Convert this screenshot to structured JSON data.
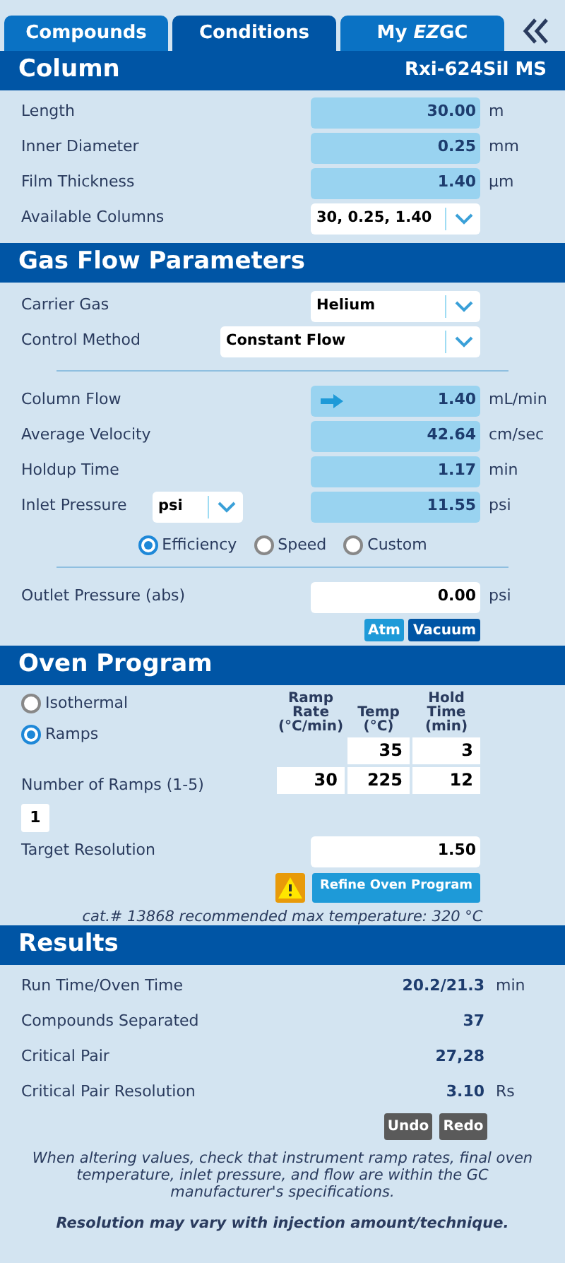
{
  "tabs": [
    {
      "label": "Compounds",
      "selected": false
    },
    {
      "label": "Conditions",
      "selected": true
    },
    {
      "parts": [
        {
          "text": "My ",
          "italic": false
        },
        {
          "text": "EZ",
          "italic": true
        },
        {
          "text": "GC",
          "italic": false
        }
      ],
      "selected": false
    }
  ],
  "column": {
    "title": "Column",
    "name": "Rxi-624Sil MS",
    "fields": [
      {
        "label": "Length",
        "value": "30.00",
        "unit": "m"
      },
      {
        "label": "Inner Diameter",
        "value": "0.25",
        "unit": "mm"
      },
      {
        "label": "Film Thickness",
        "value": "1.40",
        "unit": "µm"
      }
    ],
    "available": {
      "label": "Available Columns",
      "value": "30, 0.25, 1.40"
    }
  },
  "gas_flow": {
    "title": "Gas Flow Parameters",
    "selects": [
      {
        "label": "Carrier Gas",
        "value": "Helium",
        "kind": "short"
      },
      {
        "label": "Control Method",
        "value": "Constant Flow",
        "kind": "wide"
      }
    ],
    "fields": [
      {
        "label": "Column Flow",
        "value": "1.40",
        "unit": "mL/min",
        "kind": "arrow"
      },
      {
        "label": "Average Velocity",
        "value": "42.64",
        "unit": "cm/sec",
        "kind": "plain"
      },
      {
        "label": "Holdup Time",
        "value": "1.17",
        "unit": "min",
        "kind": "plain"
      }
    ],
    "inlet": {
      "label": "Inlet Pressure",
      "unit_select": "psi",
      "value": "11.55",
      "unit": "psi"
    },
    "modes": [
      {
        "label": "Efficiency",
        "selected": true
      },
      {
        "label": "Speed",
        "selected": false
      },
      {
        "label": "Custom",
        "selected": false
      }
    ],
    "outlet": {
      "label": "Outlet Pressure (abs)",
      "value": "0.00",
      "unit": "psi"
    },
    "buttons": [
      {
        "label": "Atm",
        "kind": "light"
      },
      {
        "label": "Vacuum",
        "kind": "dark"
      }
    ]
  },
  "oven": {
    "title": "Oven Program",
    "modes": [
      {
        "label": "Isothermal",
        "selected": false
      },
      {
        "label": "Ramps",
        "selected": true
      }
    ],
    "headers": [
      "Ramp Rate (°C/min)",
      "Temp (°C)",
      "Hold Time (min)"
    ],
    "rows": [
      [
        null,
        "35",
        "3"
      ],
      [
        "30",
        "225",
        "12"
      ]
    ],
    "ramps": {
      "label": "Number of Ramps (1-5)",
      "value": "1"
    },
    "target": {
      "label": "Target Resolution",
      "value": "1.50"
    },
    "refine": "Refine Oven Program",
    "note": "cat.# 13868 recommended max temperature: 320 °C"
  },
  "results": {
    "title": "Results",
    "rows": [
      {
        "label": "Run Time/Oven Time",
        "value": "20.2/21.3",
        "unit": "min"
      },
      {
        "label": "Compounds Separated",
        "value": "37"
      },
      {
        "label": "Critical Pair",
        "value": "27,28"
      },
      {
        "label": "Critical Pair Resolution",
        "value": "3.10",
        "unit": "Rs"
      }
    ],
    "buttons": [
      "Undo",
      "Redo"
    ],
    "notes": [
      {
        "text": "When altering values, check that instrument ramp rates, final oven temperature, inlet pressure, and flow are within the GC manufacturer's specifications.",
        "bold": false
      },
      {
        "text": "Resolution may vary with injection amount/technique.",
        "bold": true
      }
    ]
  }
}
